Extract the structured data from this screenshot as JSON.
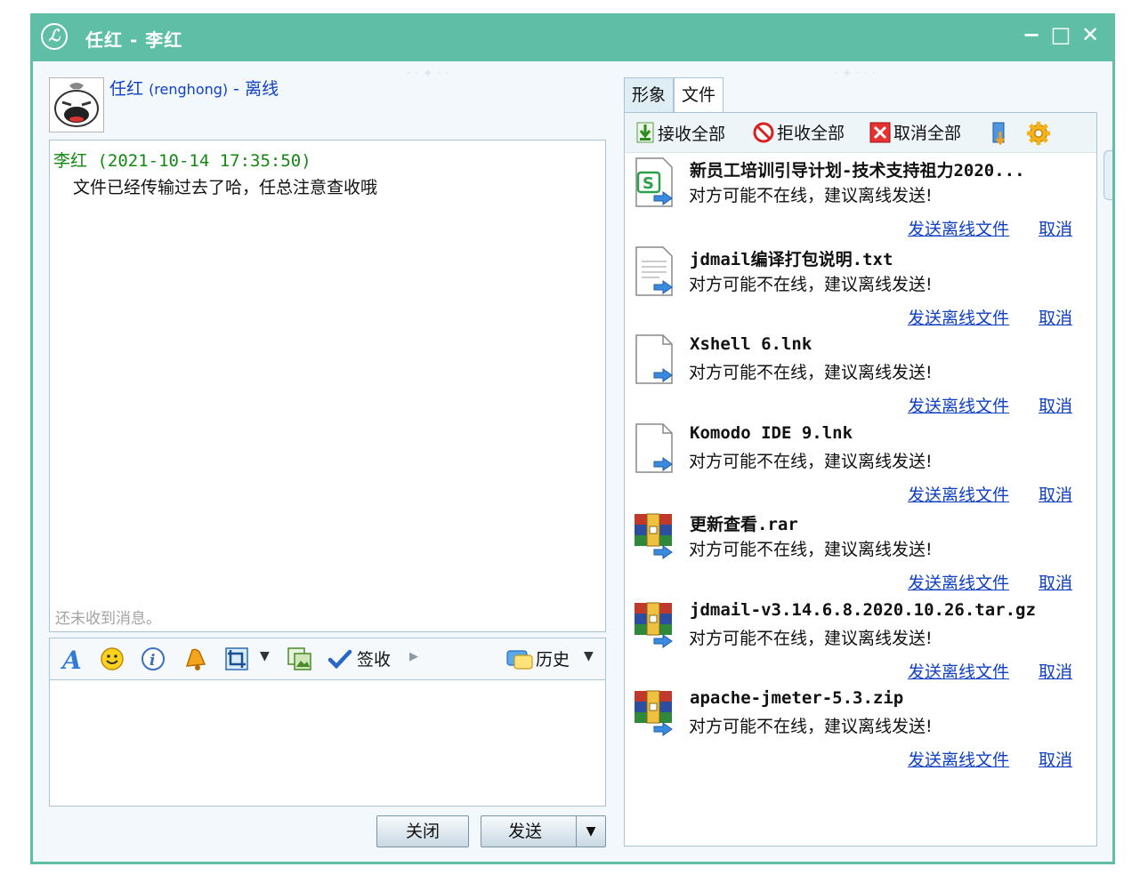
{
  "window": {
    "title": "任红 - 李红",
    "app_icon": "ℒ",
    "controls": {
      "minimize": "−",
      "maximize": "□",
      "close": "✕"
    }
  },
  "contact": {
    "name": "任红",
    "pinyin": "(renghong)",
    "separator": " - ",
    "status": "离线"
  },
  "chat": {
    "messages": [
      {
        "sender": "李红",
        "time": "(2021-10-14 17:35:50)",
        "text": "文件已经传输过去了哈，任总注意查收哦"
      }
    ],
    "no_message_hint": "还未收到消息。"
  },
  "toolbar": {
    "sign_label": "签收",
    "history_label": "历史"
  },
  "buttons": {
    "close": "关闭",
    "send": "发送"
  },
  "tabs": [
    {
      "label": "形象"
    },
    {
      "label": "文件"
    }
  ],
  "file_toolbar": {
    "accept_all": "接收全部",
    "reject_all": "拒收全部",
    "cancel_all": "取消全部"
  },
  "files": [
    {
      "name": "新员工培训引导计划-技术支持祖力2020...",
      "icon": "spreadsheet-file-icon",
      "status": "对方可能不在线，建议离线发送!",
      "send_offline": "发送离线文件",
      "cancel": "取消"
    },
    {
      "name": "jdmail编译打包说明.txt",
      "icon": "text-file-icon",
      "status": "对方可能不在线，建议离线发送!",
      "send_offline": "发送离线文件",
      "cancel": "取消"
    },
    {
      "name": "Xshell 6.lnk",
      "icon": "blank-file-icon",
      "status": "对方可能不在线，建议离线发送!",
      "send_offline": "发送离线文件",
      "cancel": "取消"
    },
    {
      "name": "Komodo IDE 9.lnk",
      "icon": "blank-file-icon",
      "status": "对方可能不在线，建议离线发送!",
      "send_offline": "发送离线文件",
      "cancel": "取消"
    },
    {
      "name": "更新查看.rar",
      "icon": "archive-file-icon",
      "status": "对方可能不在线，建议离线发送!",
      "send_offline": "发送离线文件",
      "cancel": "取消"
    },
    {
      "name": "jdmail-v3.14.6.8.2020.10.26.tar.gz",
      "icon": "archive-file-icon",
      "status": "对方可能不在线，建议离线发送!",
      "send_offline": "发送离线文件",
      "cancel": "取消"
    },
    {
      "name": "apache-jmeter-5.3.zip",
      "icon": "archive-file-icon",
      "status": "对方可能不在线，建议离线发送!",
      "send_offline": "发送离线文件",
      "cancel": "取消"
    }
  ],
  "colors": {
    "titlebar": "#5fbfa6",
    "link": "#1140c4",
    "sender": "#118811"
  }
}
